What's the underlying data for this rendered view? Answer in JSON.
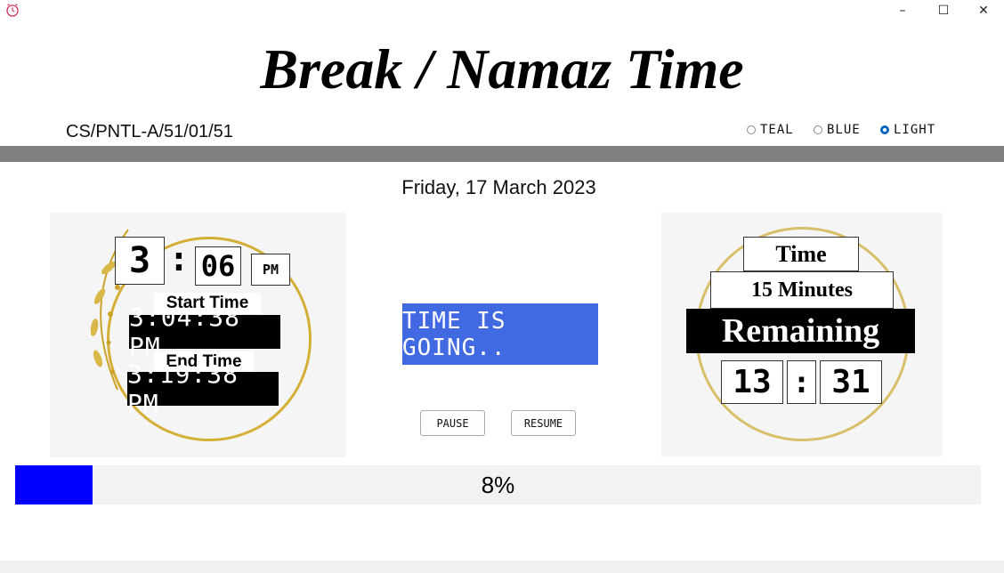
{
  "window": {
    "app_icon": "alarm-clock-icon",
    "controls": {
      "minimize": "–",
      "maximize": "☐",
      "close": "✕"
    }
  },
  "header": {
    "title": "Break / Namaz Time",
    "code": "CS/PNTL-A/51/01/51"
  },
  "theme": {
    "options": [
      {
        "label": "TEAL",
        "checked": false
      },
      {
        "label": "BLUE",
        "checked": false
      },
      {
        "label": "LIGHT",
        "checked": true
      }
    ],
    "accent": "#0067c0",
    "divider_color": "#808080"
  },
  "date": "Friday, 17 March 2023",
  "clock": {
    "hour": "3",
    "separator": ":",
    "minute": "06",
    "ampm": "PM",
    "start_label": "Start Time",
    "start_time": "3:04:38 PM",
    "end_label": "End Time",
    "end_time": "3:19:38 PM"
  },
  "status": {
    "message": "TIME IS GOING..",
    "color": "#4169e1",
    "pause_label": "PAUSE",
    "resume_label": "RESUME"
  },
  "remaining": {
    "line1": "Time",
    "line2": "15 Minutes",
    "line3": "Remaining",
    "minutes": "13",
    "separator": ":",
    "seconds": "31"
  },
  "progress": {
    "value": 0.08,
    "label": "8%",
    "color": "#0000ff"
  }
}
